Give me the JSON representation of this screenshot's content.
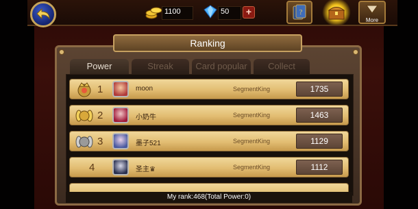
{
  "header": {
    "gold": "1100",
    "gems": "50",
    "plus_label": "+",
    "more_label": "More",
    "icons": [
      "back-arrow-icon",
      "gold-coins-icon",
      "blue-gem-icon",
      "card-deck-icon",
      "treasure-chest-icon",
      "dropdown-arrow-icon"
    ]
  },
  "panel": {
    "title": "Ranking",
    "tabs": [
      {
        "label": "Power",
        "active": true
      },
      {
        "label": "Streak",
        "active": false
      },
      {
        "label": "Card popular",
        "active": false
      },
      {
        "label": "Collect",
        "active": false
      }
    ]
  },
  "rows": [
    {
      "rank": "1",
      "name": "moon",
      "server": "SegmentKing",
      "score": "1735",
      "medal": "gold"
    },
    {
      "rank": "2",
      "name": "小奶牛",
      "server": "SegmentKing",
      "score": "1463",
      "medal": "gold"
    },
    {
      "rank": "3",
      "name": "墨子521",
      "server": "SegmentKing",
      "score": "1129",
      "medal": "silver"
    },
    {
      "rank": "4",
      "name": "圣主♛",
      "server": "SegmentKing",
      "score": "1112",
      "medal": ""
    }
  ],
  "footer": {
    "my_rank": "My rank:468(Total Power:0)"
  },
  "colors": {
    "row_gold": "#e2bd72",
    "score_bg": "#6d5142",
    "accent_gold": "#c6a060"
  }
}
